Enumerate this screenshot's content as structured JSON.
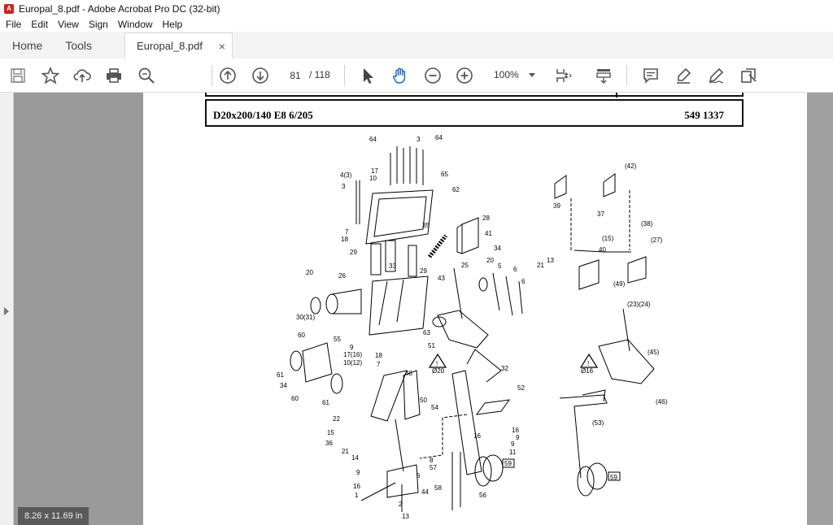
{
  "window": {
    "title": "Europal_8.pdf - Adobe Acrobat Pro DC (32-bit)"
  },
  "menu": [
    "File",
    "Edit",
    "View",
    "Sign",
    "Window",
    "Help"
  ],
  "tabs": {
    "home": "Home",
    "tools": "Tools",
    "document": "Europal_8.pdf",
    "close": "×"
  },
  "toolbar": {
    "current_page": "81",
    "total_pages": "/ 118",
    "zoom": "100%",
    "icons": [
      "save-icon",
      "bookmark-star-icon",
      "upload-icon",
      "print-icon",
      "search-zoom-icon",
      "prev-page-icon",
      "next-page-icon",
      "select-cursor-icon",
      "hand-pan-icon",
      "zoom-out-icon",
      "zoom-in-icon",
      "fit-page-icon",
      "scroll-mode-icon",
      "comment-icon",
      "highlight-pen-icon",
      "fill-sign-icon",
      "more-tools-icon"
    ]
  },
  "status": {
    "page_size": "8.26 x 11.69 in"
  },
  "document": {
    "header_left": "D20x200/140 E8 6/205",
    "header_right": "549 1337",
    "labels": [
      "64",
      "3",
      "64",
      "17",
      "10",
      "65",
      "4(3)",
      "3",
      "62",
      "35",
      "28",
      "41",
      "34",
      "7",
      "18",
      "29",
      "33",
      "29",
      "25",
      "20",
      "5",
      "6",
      "6",
      "20",
      "26",
      "43",
      "30(31)",
      "55",
      "63",
      "9",
      "17(16)",
      "10(12)",
      "18",
      "7",
      "51",
      "60",
      "61",
      "34",
      "60",
      "61",
      "Ø20",
      "32",
      "48",
      "52",
      "50",
      "54",
      "22",
      "15",
      "36",
      "21",
      "14",
      "16",
      "9",
      "11",
      "16",
      "9",
      "8",
      "57",
      "59",
      "58",
      "56",
      "9",
      "16",
      "1",
      "6",
      "44",
      "2",
      "13",
      "(42)",
      "39",
      "37",
      "(38)",
      "(15)",
      "(27)",
      "21",
      "13",
      "40",
      "(49)",
      "(23)(24)",
      "(45)",
      "Ø16",
      "(46)",
      "(53)",
      "59"
    ]
  }
}
